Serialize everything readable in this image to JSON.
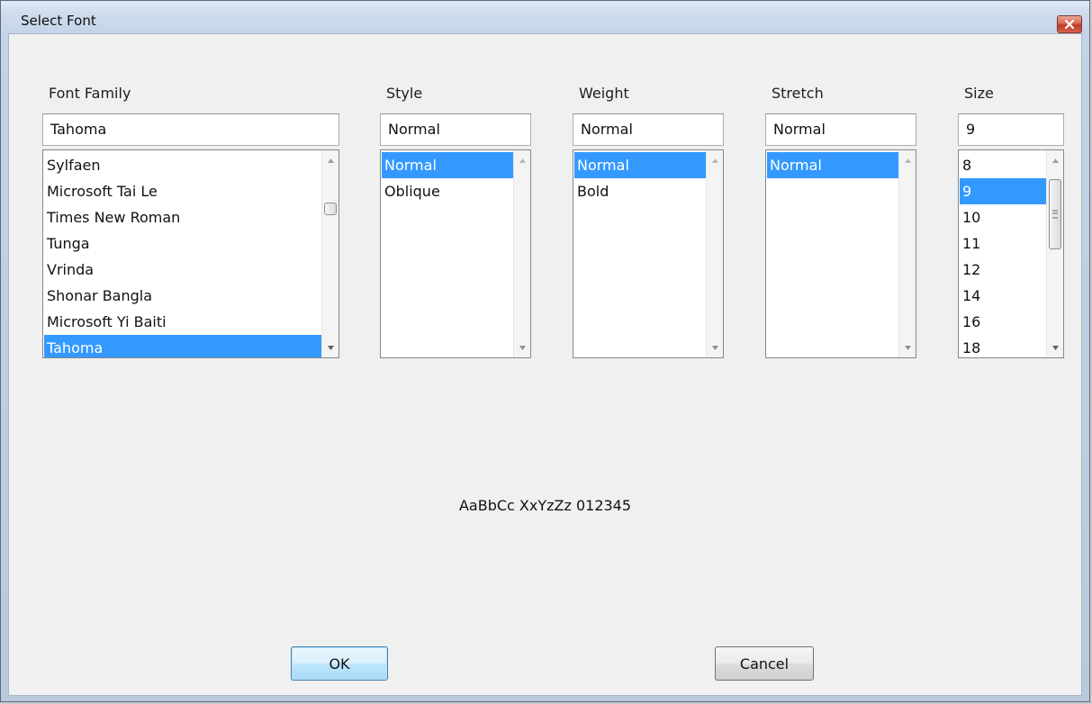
{
  "window": {
    "title": "Select Font"
  },
  "columns": {
    "family": {
      "label": "Font Family",
      "value": "Tahoma",
      "items": [
        "Sylfaen",
        "Microsoft Tai Le",
        "Times New Roman",
        "Tunga",
        "Vrinda",
        "Shonar Bangla",
        "Microsoft Yi Baiti",
        "Tahoma"
      ],
      "selected": "Tahoma"
    },
    "style": {
      "label": "Style",
      "value": "Normal",
      "items": [
        "Normal",
        "Oblique"
      ],
      "selected": "Normal"
    },
    "weight": {
      "label": "Weight",
      "value": "Normal",
      "items": [
        "Normal",
        "Bold"
      ],
      "selected": "Normal"
    },
    "stretch": {
      "label": "Stretch",
      "value": "Normal",
      "items": [
        "Normal"
      ],
      "selected": "Normal"
    },
    "size": {
      "label": "Size",
      "value": "9",
      "items": [
        "8",
        "9",
        "10",
        "11",
        "12",
        "14",
        "16",
        "18"
      ],
      "selected": "9"
    }
  },
  "preview": {
    "text": "AaBbCc XxYzZz 012345"
  },
  "buttons": {
    "ok": "OK",
    "cancel": "Cancel"
  },
  "colors": {
    "selection": "#3399ff",
    "dialog_bg": "#f0f0f0",
    "close_button": "#c0392b"
  }
}
